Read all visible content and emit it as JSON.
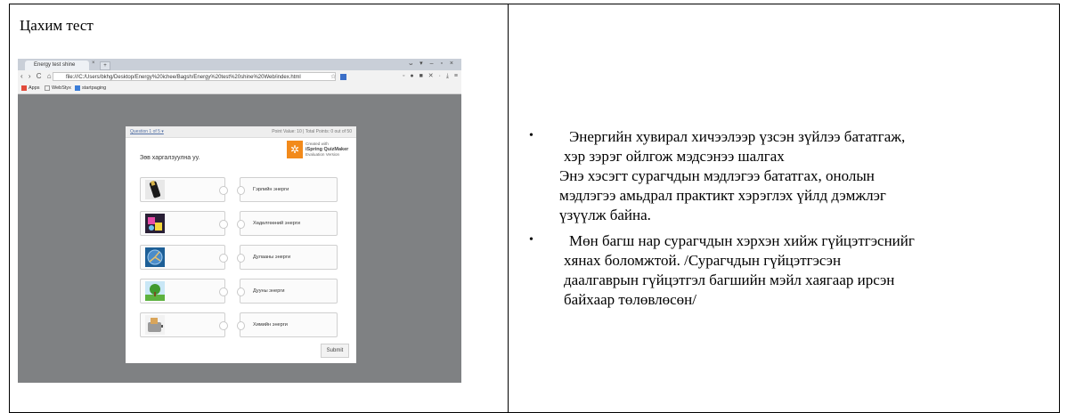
{
  "left_cell": {
    "title": "Цахим тест",
    "screenshot": {
      "tab_title": "Energy test shine",
      "url": "file:///C:/Users/bkhg/Desktop/Energy%20ichee/Bagsh/Energy%20test%20shine%20Web/index.html",
      "bookmarks": [
        "Apps",
        "WebStyx",
        "startpaging"
      ],
      "question_label": "Question 1 of 5 ▾",
      "points_label": "Point Value: 10  |  Total Points: 0 out of 50",
      "brand_top": "Created with",
      "brand_name": "iSpring QuizMaker",
      "brand_sub": "Evaluation Version",
      "prompt": "Зөв харгалзуулна уу.",
      "answers": [
        "Гэрлийн энерги",
        "Хөдөлгөөний энерги",
        "Дулааны энерги",
        "Дууны энерги",
        "Химийн энерги"
      ],
      "submit_label": "Submit"
    }
  },
  "right_cell": {
    "bullet1_lines": [
      "Энергийн хувирал хичээлээр үзсэн зүйлээ бататгаж,",
      "хэр зэрэг ойлгож мэдсэнээ шалгах",
      "Энэ хэсэгт сурагчдын мэдлэгээ бататгах, онолын",
      "мэдлэгээ амьдрал практикт хэрэглэх үйлд дэмжлэг",
      "үзүүлж байна."
    ],
    "bullet2_lines": [
      "Мөн багш нар сурагчдын хэрхэн хийж гүйцэтгэснийг",
      "хянах боломжтой. /Сурагчдын гүйцэтгэсэн",
      "даалгаврын гүйцэтгэл багшийн мэйл хаягаар ирсэн",
      "байхаар төлөвлөсөн/"
    ],
    "bullet_glyph": "•"
  }
}
